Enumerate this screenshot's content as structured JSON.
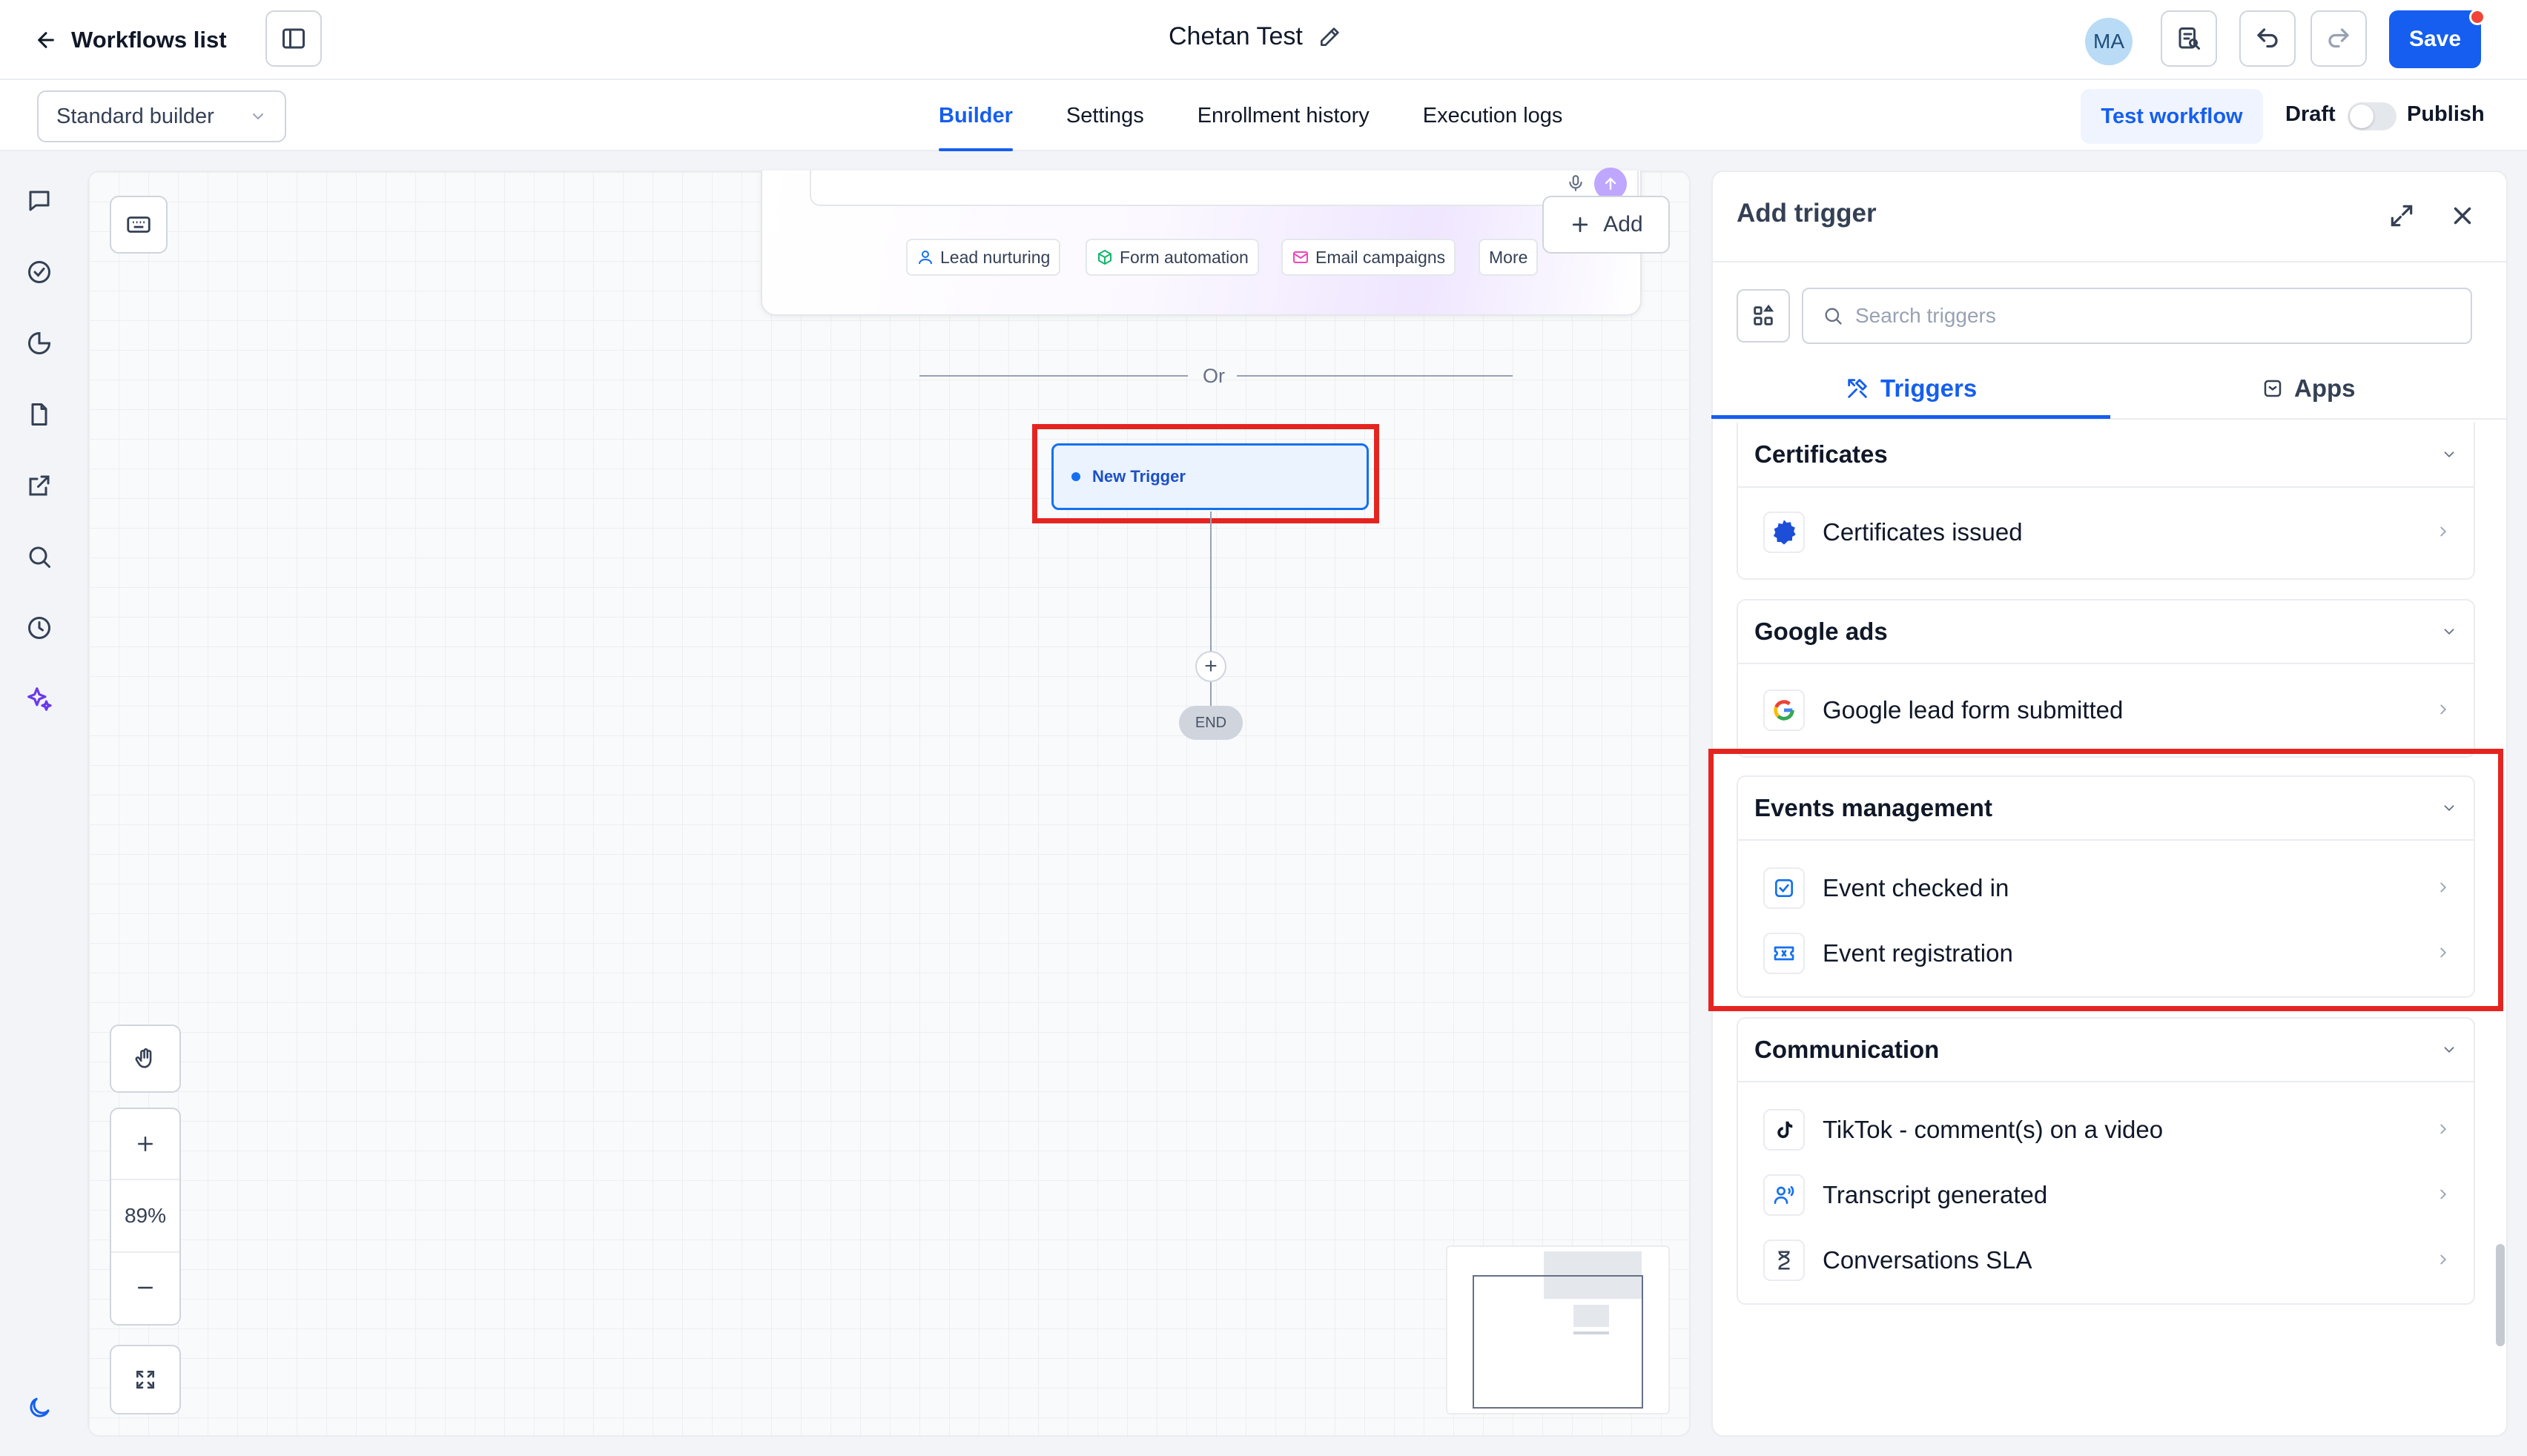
{
  "header": {
    "back_label": "Workflows list",
    "workflow_title": "Chetan Test",
    "avatar_initials": "MA",
    "save_label": "Save"
  },
  "subbar": {
    "builder_select": "Standard builder",
    "tabs": [
      "Builder",
      "Settings",
      "Enrollment history",
      "Execution logs"
    ],
    "active_tab": "Builder",
    "test_workflow_label": "Test workflow",
    "draft_label": "Draft",
    "publish_label": "Publish",
    "publish_enabled": false
  },
  "left_rail": {
    "icons": [
      "chat-icon",
      "check-circle-icon",
      "pie-chart-icon",
      "document-icon",
      "external-link-icon",
      "search-icon",
      "history-icon",
      "sparkles-icon",
      "moon-icon"
    ]
  },
  "canvas": {
    "suggestion_chips": [
      "Lead nurturing",
      "Form automation",
      "Email campaigns",
      "More"
    ],
    "add_label": "Add",
    "or_label": "Or",
    "trigger_node_label": "New Trigger",
    "end_label": "END",
    "zoom_level": "89%"
  },
  "panel": {
    "title": "Add trigger",
    "search_placeholder": "Search triggers",
    "tabs": [
      "Triggers",
      "Apps"
    ],
    "active_tab": "Triggers",
    "categories": [
      {
        "title": "Certificates",
        "items": [
          {
            "label": "Certificates issued",
            "icon": "badge-icon"
          }
        ]
      },
      {
        "title": "Google ads",
        "items": [
          {
            "label": "Google lead form submitted",
            "icon": "google-icon"
          }
        ]
      },
      {
        "title": "Events management",
        "items": [
          {
            "label": "Event checked in",
            "icon": "checkbox-icon"
          },
          {
            "label": "Event registration",
            "icon": "ticket-icon"
          }
        ]
      },
      {
        "title": "Communication",
        "items": [
          {
            "label": "TikTok - comment(s) on a video",
            "icon": "tiktok-icon"
          },
          {
            "label": "Transcript generated",
            "icon": "voice-icon"
          },
          {
            "label": "Conversations SLA",
            "icon": "hourglass-icon"
          }
        ]
      }
    ]
  },
  "colors": {
    "accent": "#155eef",
    "highlight": "#e52420",
    "trigger_fill": "#eaf3ff"
  }
}
